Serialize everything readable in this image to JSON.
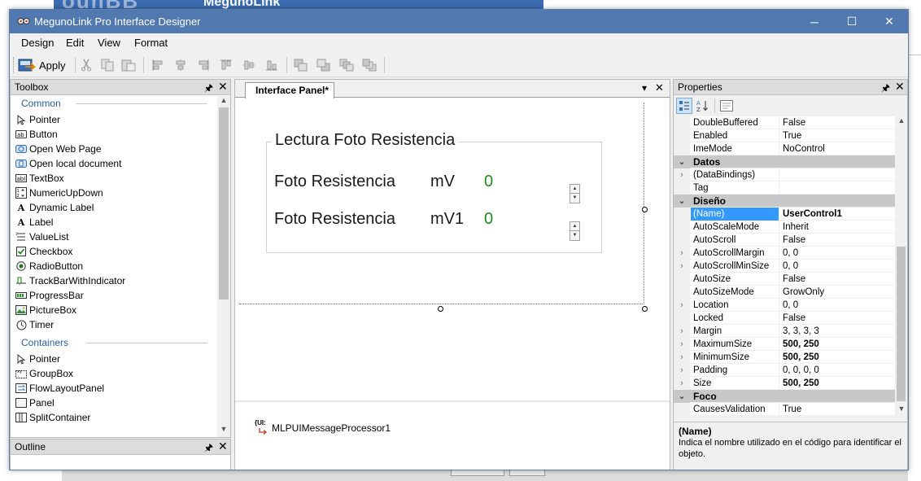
{
  "background": {
    "ghost_title": "ounBB",
    "ghost_brand": "MegunoLink"
  },
  "window": {
    "title": "MegunoLink Pro Interface Designer",
    "controls": {
      "minimize": "─",
      "maximize": "☐",
      "close": "✕"
    }
  },
  "menu": [
    "Design",
    "Edit",
    "View",
    "Format"
  ],
  "toolbar": {
    "apply_label": "Apply",
    "icons": [
      "cut-icon",
      "copy-icon",
      "paste-icon",
      "align-left-icon",
      "align-center-icon",
      "align-right-icon",
      "align-top-icon",
      "align-middle-icon",
      "align-bottom-icon",
      "bring-to-front-icon",
      "send-to-back-icon",
      "bring-forward-icon",
      "send-backward-icon"
    ]
  },
  "toolbox": {
    "title": "Toolbox",
    "pin": "🖈",
    "close": "✕",
    "groups": [
      {
        "name": "Common",
        "items": [
          {
            "label": "Pointer",
            "icon": "pointer-icon"
          },
          {
            "label": "Button",
            "icon": "button-icon"
          },
          {
            "label": "Open Web Page",
            "icon": "web-page-icon"
          },
          {
            "label": "Open local document",
            "icon": "local-document-icon"
          },
          {
            "label": "TextBox",
            "icon": "textbox-icon"
          },
          {
            "label": "NumericUpDown",
            "icon": "numeric-updown-icon"
          },
          {
            "label": "Dynamic Label",
            "icon": "dynamic-label-icon"
          },
          {
            "label": "Label",
            "icon": "label-icon"
          },
          {
            "label": "ValueList",
            "icon": "valuelist-icon"
          },
          {
            "label": "Checkbox",
            "icon": "checkbox-icon"
          },
          {
            "label": "RadioButton",
            "icon": "radiobutton-icon"
          },
          {
            "label": "TrackBarWithIndicator",
            "icon": "trackbar-icon"
          },
          {
            "label": "ProgressBar",
            "icon": "progressbar-icon"
          },
          {
            "label": "PictureBox",
            "icon": "picturebox-icon"
          },
          {
            "label": "Timer",
            "icon": "timer-icon"
          }
        ]
      },
      {
        "name": "Containers",
        "items": [
          {
            "label": "Pointer",
            "icon": "pointer-icon"
          },
          {
            "label": "GroupBox",
            "icon": "groupbox-icon"
          },
          {
            "label": "FlowLayoutPanel",
            "icon": "flowlayoutpanel-icon"
          },
          {
            "label": "Panel",
            "icon": "panel-icon"
          },
          {
            "label": "SplitContainer",
            "icon": "splitcontainer-icon"
          }
        ]
      }
    ]
  },
  "outline": {
    "title": "Outline"
  },
  "designer": {
    "tab_label": "Interface Panel*",
    "groupbox_title": "Lectura Foto Resistencia",
    "rows": [
      {
        "label": "Foto Resistencia",
        "unit": "mV",
        "value": "0"
      },
      {
        "label": "Foto Resistencia",
        "unit": "mV1",
        "value": "0"
      }
    ],
    "tray_component": "MLPUIMessageProcessor1",
    "tray_icon_text": "{UI:"
  },
  "properties": {
    "title": "Properties",
    "rows": [
      {
        "type": "prop",
        "name": "DoubleBuffered",
        "value": "False"
      },
      {
        "type": "prop",
        "name": "Enabled",
        "value": "True"
      },
      {
        "type": "prop",
        "name": "ImeMode",
        "value": "NoControl"
      },
      {
        "type": "cat",
        "name": "Datos"
      },
      {
        "type": "prop",
        "name": "(DataBindings)",
        "value": "",
        "expand": true
      },
      {
        "type": "prop",
        "name": "Tag",
        "value": ""
      },
      {
        "type": "cat",
        "name": "Diseño"
      },
      {
        "type": "prop",
        "name": "(Name)",
        "value": "UserControl1",
        "bold": true,
        "selected": true
      },
      {
        "type": "prop",
        "name": "AutoScaleMode",
        "value": "Inherit"
      },
      {
        "type": "prop",
        "name": "AutoScroll",
        "value": "False"
      },
      {
        "type": "prop",
        "name": "AutoScrollMargin",
        "value": "0, 0",
        "expand": true
      },
      {
        "type": "prop",
        "name": "AutoScrollMinSize",
        "value": "0, 0",
        "expand": true
      },
      {
        "type": "prop",
        "name": "AutoSize",
        "value": "False"
      },
      {
        "type": "prop",
        "name": "AutoSizeMode",
        "value": "GrowOnly"
      },
      {
        "type": "prop",
        "name": "Location",
        "value": "0, 0",
        "expand": true
      },
      {
        "type": "prop",
        "name": "Locked",
        "value": "False"
      },
      {
        "type": "prop",
        "name": "Margin",
        "value": "3, 3, 3, 3",
        "expand": true
      },
      {
        "type": "prop",
        "name": "MaximumSize",
        "value": "500, 250",
        "bold": true,
        "expand": true
      },
      {
        "type": "prop",
        "name": "MinimumSize",
        "value": "500, 250",
        "bold": true,
        "expand": true
      },
      {
        "type": "prop",
        "name": "Padding",
        "value": "0, 0, 0, 0",
        "expand": true
      },
      {
        "type": "prop",
        "name": "Size",
        "value": "500, 250",
        "bold": true,
        "expand": true
      },
      {
        "type": "cat",
        "name": "Foco"
      },
      {
        "type": "prop",
        "name": "CausesValidation",
        "value": "True"
      }
    ],
    "description": {
      "name": "(Name)",
      "text": "Indica el nombre utilizado en el código para identificar el objeto."
    }
  }
}
